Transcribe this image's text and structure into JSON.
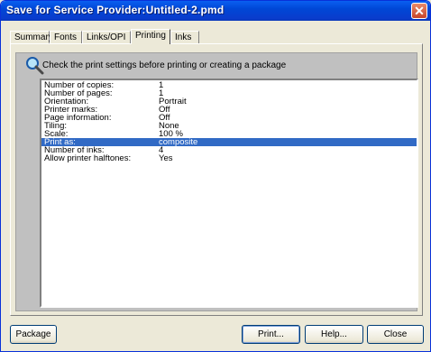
{
  "window": {
    "title": "Save for Service Provider:Untitled-2.pmd"
  },
  "tabs": [
    {
      "label": "Summary"
    },
    {
      "label": "Fonts"
    },
    {
      "label": "Links/OPI"
    },
    {
      "label": "Printing"
    },
    {
      "label": "Inks"
    }
  ],
  "active_tab": "Printing",
  "hint": "Check the print settings before printing or creating a package",
  "settings": [
    {
      "key": "Number of copies:",
      "value": "1"
    },
    {
      "key": "Number of pages:",
      "value": "1"
    },
    {
      "key": "Orientation:",
      "value": "Portrait"
    },
    {
      "key": "Printer marks:",
      "value": "Off"
    },
    {
      "key": "Page information:",
      "value": "Off"
    },
    {
      "key": "Tiling:",
      "value": "None"
    },
    {
      "key": "Scale:",
      "value": "100 %"
    },
    {
      "key": "Print as:",
      "value": "composite"
    },
    {
      "key": "Number of inks:",
      "value": "4"
    },
    {
      "key": "Allow printer halftones:",
      "value": "Yes"
    }
  ],
  "selected_setting": "Print as:",
  "buttons": {
    "package": "Package",
    "print": "Print...",
    "help": "Help...",
    "close": "Close"
  },
  "colors": {
    "titlebar": "#0054e3",
    "selection": "#316ac5",
    "close_button": "#c8452a"
  }
}
